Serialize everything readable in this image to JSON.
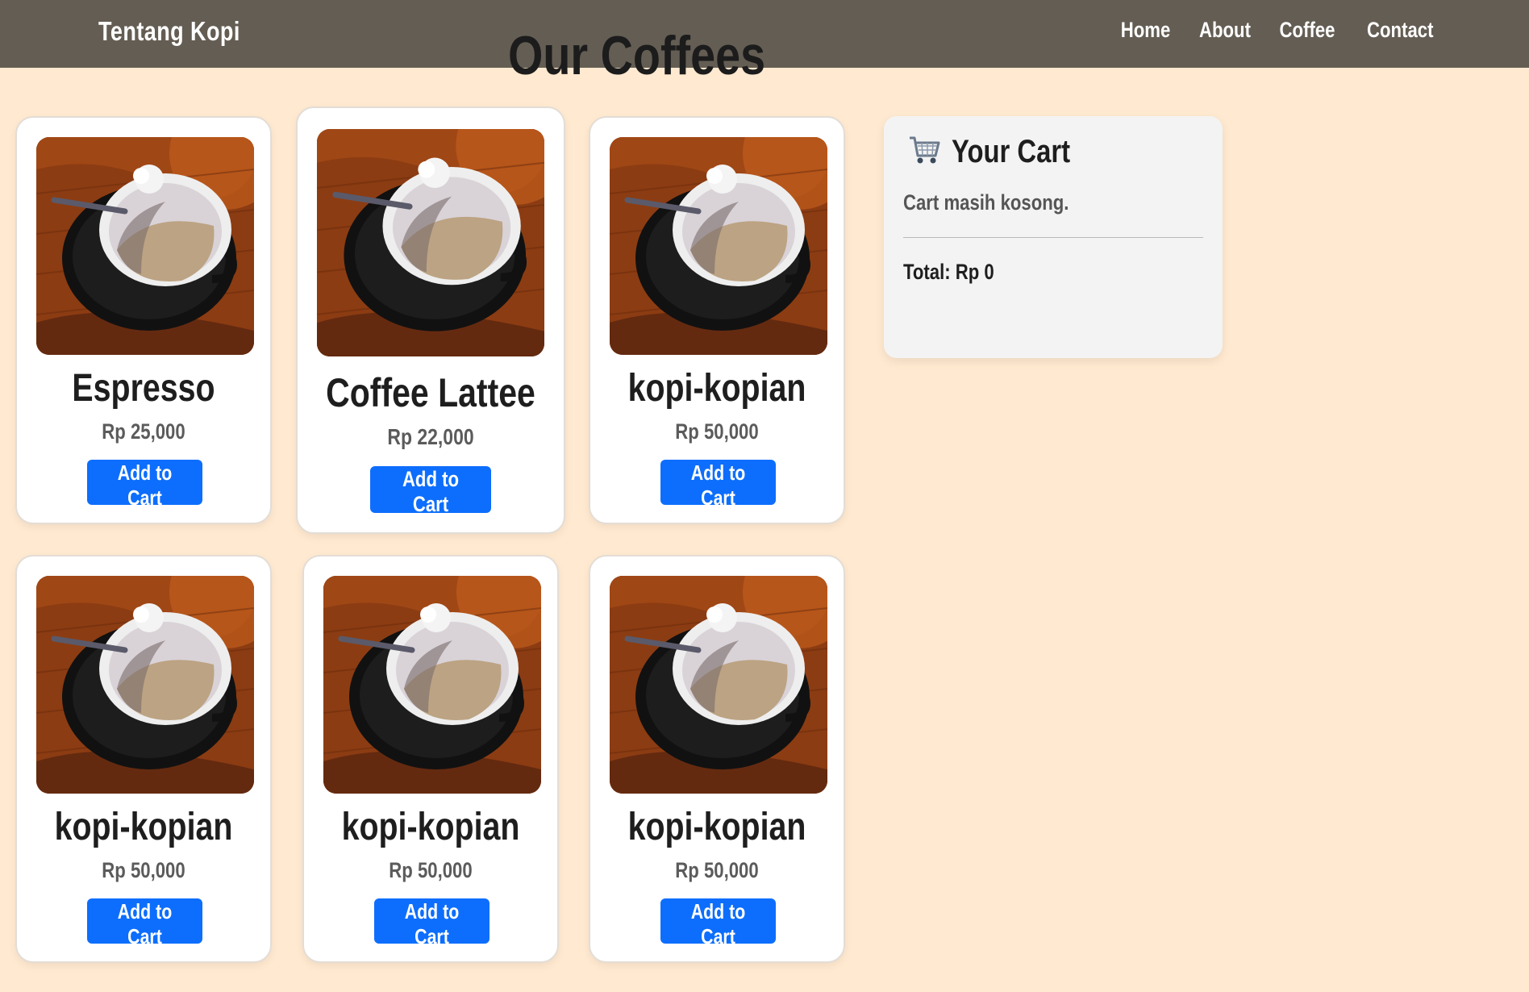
{
  "navbar": {
    "brand": "Tentang Kopi",
    "links": [
      "Home",
      "About",
      "Coffee",
      "Contact"
    ]
  },
  "page": {
    "title": "Our Coffees"
  },
  "products": [
    {
      "name": "Espresso",
      "price": "Rp 25,000",
      "button": "Add to Cart"
    },
    {
      "name": "Coffee Lattee",
      "price": "Rp 22,000",
      "button": "Add to Cart"
    },
    {
      "name": "kopi-kopian",
      "price": "Rp 50,000",
      "button": "Add to Cart"
    },
    {
      "name": "kopi-kopian",
      "price": "Rp 50,000",
      "button": "Add to Cart"
    },
    {
      "name": "kopi-kopian",
      "price": "Rp 50,000",
      "button": "Add to Cart"
    },
    {
      "name": "kopi-kopian",
      "price": "Rp 50,000",
      "button": "Add to Cart"
    }
  ],
  "cart": {
    "icon": "shopping-cart-icon",
    "title": "Your Cart",
    "empty_message": "Cart masih kosong.",
    "total": "Total: Rp 0"
  },
  "colors": {
    "navbar": "#645d53",
    "background": "#ffe9d0",
    "button": "#0d6efd"
  }
}
